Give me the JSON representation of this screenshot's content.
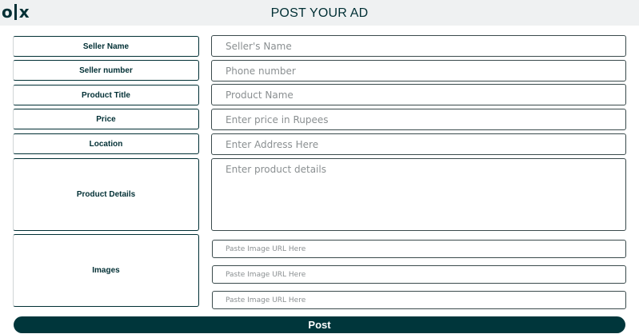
{
  "header": {
    "logo": {
      "letters": [
        "o",
        "x"
      ],
      "name": "olx-logo-icon"
    },
    "title": "POST YOUR AD"
  },
  "form": {
    "seller_name": {
      "label": "Seller Name",
      "placeholder": "Seller's Name"
    },
    "seller_number": {
      "label": "Seller number",
      "placeholder": "Phone number"
    },
    "product_title": {
      "label": "Product Title",
      "placeholder": "Product Name"
    },
    "price": {
      "label": "Price",
      "placeholder": "Enter price in Rupees"
    },
    "location": {
      "label": "Location",
      "placeholder": "Enter Address Here"
    },
    "product_details": {
      "label": "Product Details",
      "placeholder": "Enter product details"
    },
    "images": {
      "label": "Images",
      "fields": [
        {
          "placeholder": "Paste Image URL Here"
        },
        {
          "placeholder": "Paste Image URL Here"
        },
        {
          "placeholder": "Paste Image URL Here"
        }
      ]
    },
    "submit_label": "Post"
  },
  "colors": {
    "brand": "#002f34",
    "button": "#00363b",
    "header_bg": "#eff1f2"
  }
}
